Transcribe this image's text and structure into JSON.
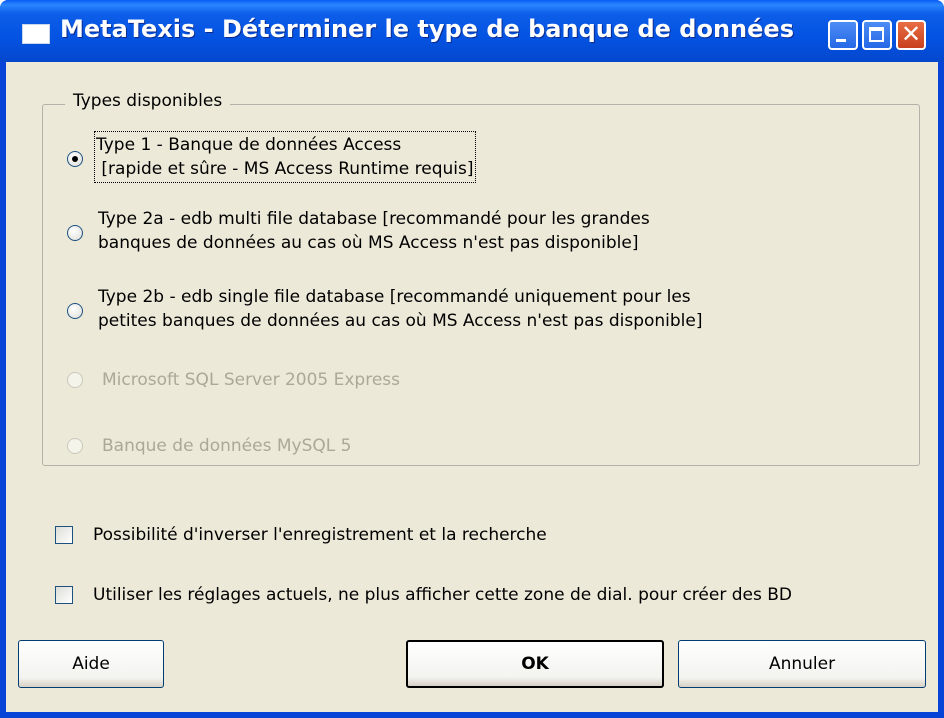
{
  "window": {
    "title": "MetaTexis - Déterminer le type de banque de données"
  },
  "group": {
    "label": "Types disponibles",
    "options": [
      {
        "label": "Type 1 - Banque de données Access\n [rapide et sûre - MS Access Runtime requis]",
        "selected": true,
        "enabled": true
      },
      {
        "label": "Type 2a - edb multi file database [recommandé pour les grandes\nbanques de données au cas où MS Access n'est pas disponible]",
        "selected": false,
        "enabled": true
      },
      {
        "label": "Type 2b - edb single file database [recommandé uniquement pour les\npetites banques de données au cas où MS Access n'est pas disponible]",
        "selected": false,
        "enabled": true
      },
      {
        "label": "Microsoft SQL Server 2005 Express",
        "selected": false,
        "enabled": false
      },
      {
        "label": "Banque de données MySQL 5",
        "selected": false,
        "enabled": false
      }
    ]
  },
  "checkboxes": [
    {
      "label": "Possibilité d'inverser l'enregistrement et la recherche",
      "checked": false
    },
    {
      "label": "Utiliser les réglages actuels, ne plus afficher cette zone de dial. pour créer des BD",
      "checked": false
    }
  ],
  "buttons": {
    "help": "Aide",
    "ok": "OK",
    "cancel": "Annuler"
  }
}
